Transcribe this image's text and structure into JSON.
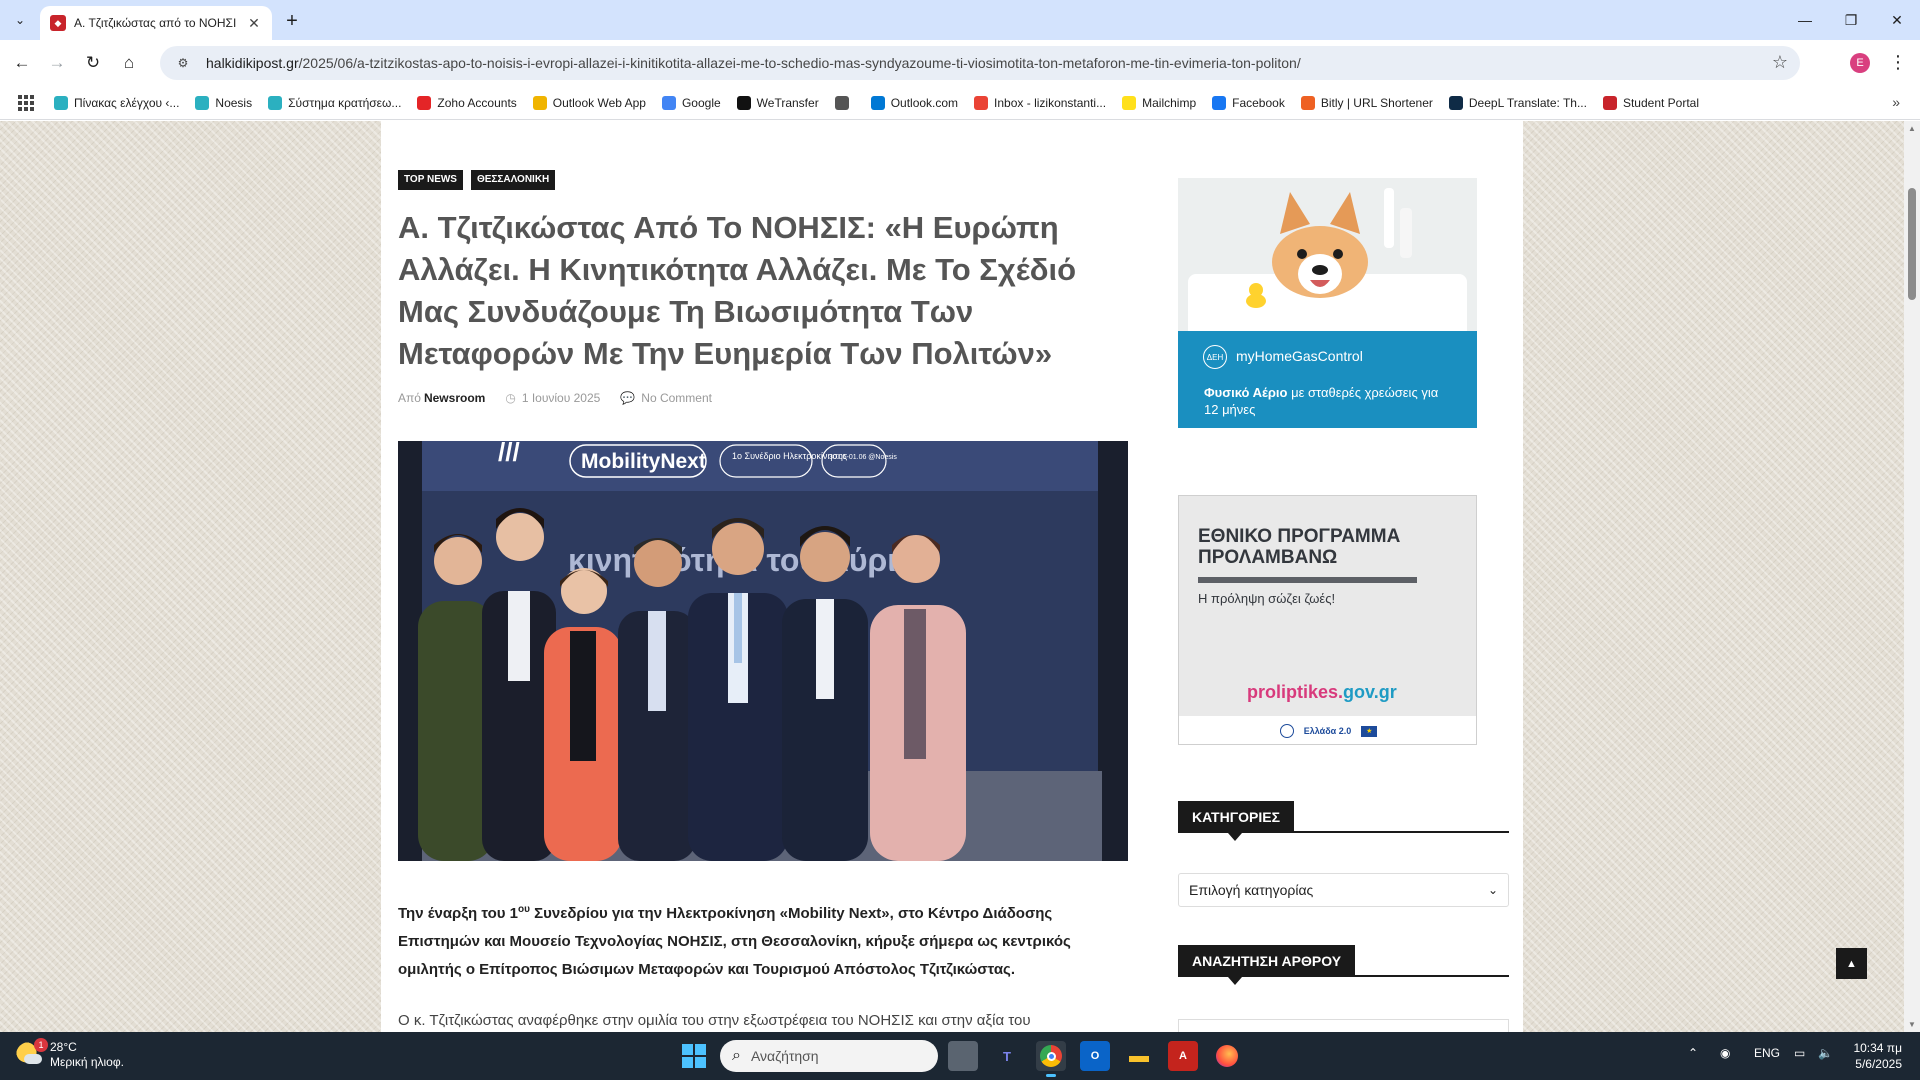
{
  "browser": {
    "tab_title": "Α. Τζιτζικώστας από το ΝΟΗΣΙ",
    "url_host": "halkidikipost.gr",
    "url_path": "/2025/06/a-tzitzikostas-apo-to-noisis-i-evropi-allazei-i-kinitikotita-allazei-me-to-schedio-mas-syndyazoume-ti-viosimotita-ton-metaforon-me-tin-evimeria-ton-politon/",
    "profile_initial": "E",
    "bookmarks": [
      {
        "label": "Πίνακας ελέγχου ‹...",
        "color": "#2bb0c0"
      },
      {
        "label": "Noesis",
        "color": "#2bb0c0"
      },
      {
        "label": "Σύστημα κρατήσεω...",
        "color": "#2bb0c0"
      },
      {
        "label": "Zoho Accounts",
        "color": "#e42527"
      },
      {
        "label": "Outlook Web App",
        "color": "#f0b400"
      },
      {
        "label": "Google",
        "color": "#4285f4"
      },
      {
        "label": "WeTransfer",
        "color": "#111111"
      },
      {
        "label": "",
        "color": "#555555"
      },
      {
        "label": "Outlook.com",
        "color": "#0078d4"
      },
      {
        "label": "Inbox - lizikonstanti...",
        "color": "#ea4335"
      },
      {
        "label": "Mailchimp",
        "color": "#ffe01b"
      },
      {
        "label": "Facebook",
        "color": "#1877f2"
      },
      {
        "label": "Bitly | URL Shortener",
        "color": "#ee6123"
      },
      {
        "label": "DeepL Translate: Th...",
        "color": "#0f2b46"
      },
      {
        "label": "Student Portal",
        "color": "#c8242b"
      }
    ]
  },
  "article": {
    "categories": [
      "TOP NEWS",
      "ΘΕΣΣΑΛΟΝΙΚΗ"
    ],
    "headline": "Α. Τζιτζικώστας Από Το ΝΟΗΣΙΣ: «Η Ευρώπη Αλλάζει. Η Κινητικότητα Αλλάζει. Με Το Σχέδιό Μας Συνδυάζουμε Τη Βιωσιμότητα Των Μεταφορών Με Την Ευημερία Των Πολιτών»",
    "by_label": "Από",
    "author": "Newsroom",
    "date": "1 Ιουνίου 2025",
    "comments": "No Comment",
    "photo_banner": {
      "brand": "MobilityNext",
      "event": "1ο Συνέδριο Ηλεκτροκίνησης",
      "dates": "30.05-01.06 @Noesis",
      "backdrop_text": "κινητικότητα του Αύριο"
    },
    "lead_pre": "Την έναρξη του 1",
    "lead_sup": "ου",
    "lead_post": " Συνεδρίου για την Ηλεκτροκίνηση «Mobility Next», στο Κέντρο Διάδοσης Επιστημών και Μουσείο Τεχνολογίας ΝΟΗΣΙΣ, στη Θεσσαλονίκη, κήρυξε σήμερα ως κεντρικός ομιλητής ο Επίτροπος Βιώσιμων Μεταφορών και Τουρισμού Απόστολος Τζιτζικώστας.",
    "paragraph": "Ο κ. Τζιτζικώστας αναφέρθηκε στην ομιλία του στην εξωστρέφεια του ΝΟΗΣΙΣ και στην αξία του"
  },
  "sidebar": {
    "ad1": {
      "brand": "myHomeGasControl",
      "logo": "ΔΕΗ",
      "text_1": "Φυσικό Αέριο",
      "text_2": " με σταθερές χρεώσεις ",
      "text_3": "για 12 μήνες"
    },
    "ad2": {
      "title": "ΕΘΝΙΚΟ ΠΡΟΓΡΑΜΜΑ ΠΡΟΛΑΜΒΑΝΩ",
      "subtitle": "Η πρόληψη σώζει ζωές!",
      "site_main": "proliptikes.",
      "site_tld": "gov.gr",
      "footer": "Ελλάδα 2.0"
    },
    "categories_title": "ΚΑΤΗΓΟΡΙΕΣ",
    "categories_select": "Επιλογή κατηγορίας",
    "search_title": "ΑΝΑΖΗΤΗΣΗ ΑΡΘΡΟΥ"
  },
  "taskbar": {
    "weather_temp": "28°C",
    "weather_desc": "Μερική ηλιοφ.",
    "weather_badge": "1",
    "search_placeholder": "Αναζήτηση",
    "lang": "ENG",
    "time": "10:34 πμ",
    "date": "5/6/2025"
  }
}
